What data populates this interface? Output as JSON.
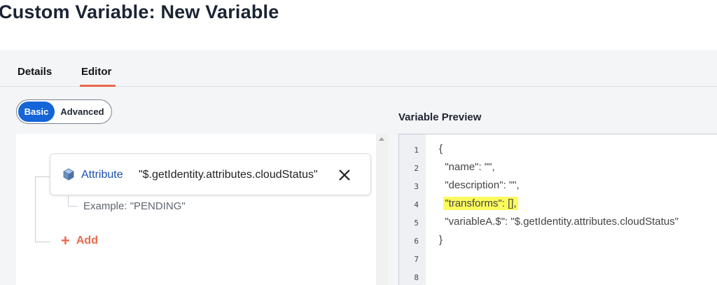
{
  "page": {
    "title": "Custom Variable: New Variable"
  },
  "tabs": [
    {
      "label": "Details",
      "active": false
    },
    {
      "label": "Editor",
      "active": true
    }
  ],
  "mode_toggle": {
    "basic_label": "Basic",
    "advanced_label": "Advanced",
    "selected": "Basic"
  },
  "builder": {
    "attribute": {
      "type_label": "Attribute",
      "value": "\"$.getIdentity.attributes.cloudStatus\"",
      "icon": "cube-icon"
    },
    "example": "Example: \"PENDING\"",
    "add_label": "Add"
  },
  "preview": {
    "title": "Variable Preview",
    "line_numbers": [
      "1",
      "2",
      "3",
      "4",
      "5",
      "6",
      "7",
      "8"
    ],
    "lines": [
      "{",
      "  \"name\": \"\",",
      "  \"description\": \"\",",
      "",
      "  \"variableA.$\": \"$.getIdentity.attributes.cloudStatus\"",
      "}",
      "",
      ""
    ],
    "highlighted_line": "\"transforms\": [],"
  },
  "colors": {
    "accent": "#e8694a",
    "primary": "#1565d8",
    "highlight": "#fcfb5c"
  }
}
